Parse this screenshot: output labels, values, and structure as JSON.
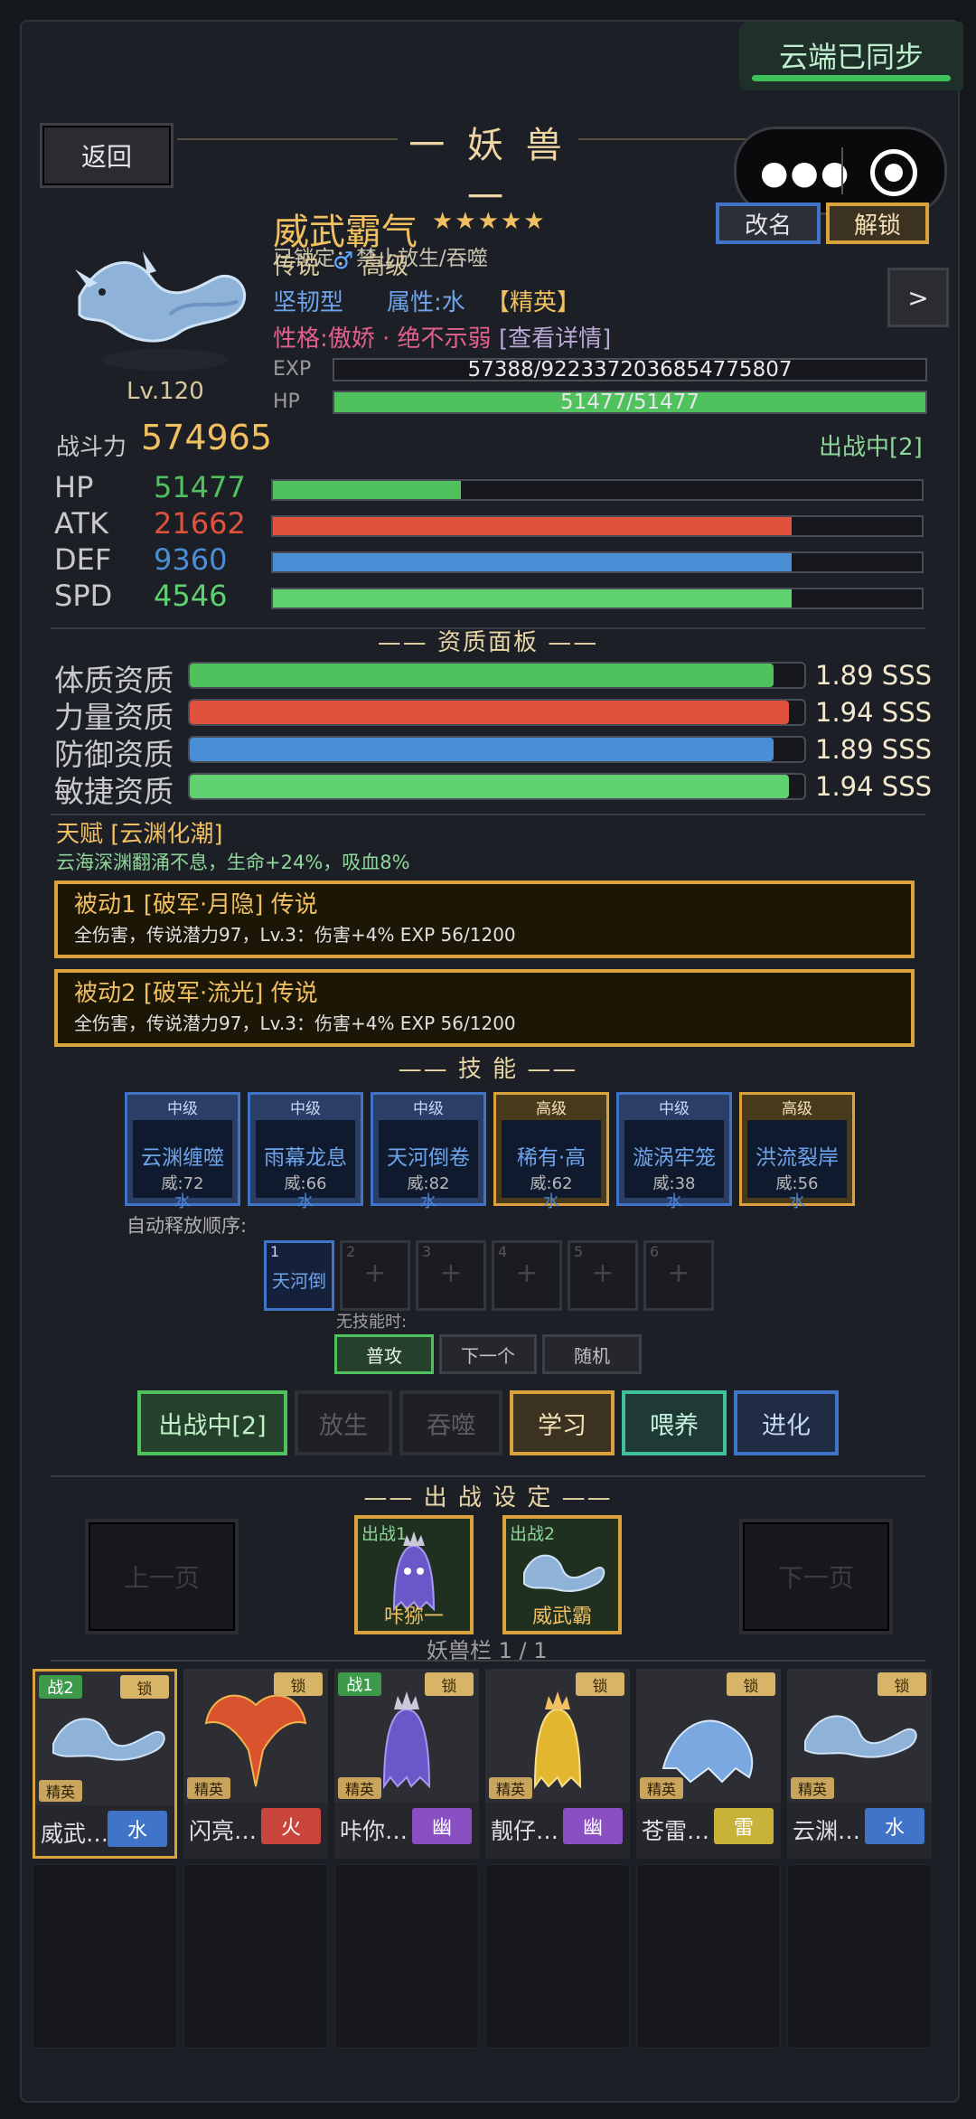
{
  "header": {
    "cloud_status": "云端已同步",
    "back": "返回",
    "title": "一 妖 兽 一"
  },
  "pet": {
    "name": "威武霸气",
    "stars": "★★★★★",
    "lock_info": "已锁定：禁止放生/吞噬",
    "rarity": "传说",
    "gender": "♂",
    "grade": "高级",
    "type": "坚韧型",
    "attr": "属性:水",
    "rank": "【精英】",
    "personality": "性格:傲娇 · 绝不示弱",
    "detail_link": "[查看详情]",
    "level": "Lv.120",
    "exp_label": "EXP",
    "exp_text": "57388/9223372036854775807",
    "exp_fraction": 0.0,
    "hp_label": "HP",
    "hp_text": "51477/51477",
    "hp_fraction": 1.0,
    "rename": "改名",
    "unlock": "解锁",
    "next": ">",
    "power_label": "战斗力",
    "power": "574965",
    "deploy_status": "出战中[2]"
  },
  "stats": [
    {
      "label": "HP",
      "value": "51477",
      "fraction": 0.29,
      "color": "#4fc25e"
    },
    {
      "label": "ATK",
      "value": "21662",
      "fraction": 0.8,
      "color": "#e0523e"
    },
    {
      "label": "DEF",
      "value": "9360",
      "fraction": 0.8,
      "color": "#4a8fd6"
    },
    {
      "label": "SPD",
      "value": "4546",
      "fraction": 0.8,
      "color": "#5fd16e"
    }
  ],
  "aptitude": {
    "title": "—— 资质面板 ——",
    "rows": [
      {
        "label": "体质资质",
        "value": "1.89 SSS",
        "fraction": 0.95,
        "color": "#4fc25e"
      },
      {
        "label": "力量资质",
        "value": "1.94 SSS",
        "fraction": 0.975,
        "color": "#e0523e"
      },
      {
        "label": "防御资质",
        "value": "1.89 SSS",
        "fraction": 0.95,
        "color": "#4a8fd6"
      },
      {
        "label": "敏捷资质",
        "value": "1.94 SSS",
        "fraction": 0.975,
        "color": "#5fd16e"
      }
    ]
  },
  "talent": {
    "title": "天赋 [云渊化潮]",
    "desc": "云海深渊翻涌不息，生命+24%，吸血8%"
  },
  "passives": [
    {
      "title": "被动1 [破军·月隐] 传说",
      "desc": "全伤害，传说潜力97，Lv.3：伤害+4%  EXP 56/1200"
    },
    {
      "title": "被动2 [破军·流光] 传说",
      "desc": "全伤害，传说潜力97，Lv.3：伤害+4%  EXP 56/1200"
    }
  ],
  "skills": {
    "title": "—— 技 能 ——",
    "items": [
      {
        "level": "中级",
        "name": "云渊缠噬",
        "power": "威:72",
        "element": "水",
        "tier": "mid"
      },
      {
        "level": "中级",
        "name": "雨幕龙息",
        "power": "威:66",
        "element": "水",
        "tier": "mid"
      },
      {
        "level": "中级",
        "name": "天河倒卷",
        "power": "威:82",
        "element": "水",
        "tier": "mid"
      },
      {
        "level": "高级",
        "name": "稀有·高",
        "power": "威:62",
        "element": "水",
        "tier": "high"
      },
      {
        "level": "中级",
        "name": "漩涡牢笼",
        "power": "威:38",
        "element": "水",
        "tier": "mid"
      },
      {
        "level": "高级",
        "name": "洪流裂岸",
        "power": "威:56",
        "element": "水",
        "tier": "high"
      }
    ],
    "auto_label": "自动释放顺序:",
    "slots": [
      {
        "num": "1",
        "text": "天河倒"
      },
      {
        "num": "2",
        "text": "+"
      },
      {
        "num": "3",
        "text": "+"
      },
      {
        "num": "4",
        "text": "+"
      },
      {
        "num": "5",
        "text": "+"
      },
      {
        "num": "6",
        "text": "+"
      }
    ],
    "no_skill_label": "无技能时:",
    "fallback": [
      "普攻",
      "下一个",
      "随机"
    ]
  },
  "actions": [
    "出战中[2]",
    "放生",
    "吞噬",
    "学习",
    "喂养",
    "进化"
  ],
  "deploy": {
    "title": "—— 出 战 设 定 ——",
    "prev": "上一页",
    "next": "下一页",
    "teams": [
      {
        "label": "出战1",
        "name": "咔猕一"
      },
      {
        "label": "出战2",
        "name": "威武霸"
      }
    ],
    "bag_label": "妖兽栏 1 / 1"
  },
  "roster": [
    {
      "badge": "战2",
      "lock": "锁",
      "rank": "精英",
      "name": "威武…",
      "element": "水",
      "el_color": "#3f74c9",
      "art": "dragon"
    },
    {
      "badge": "",
      "lock": "锁",
      "rank": "精英",
      "name": "闪亮…",
      "element": "火",
      "el_color": "#c9443a",
      "art": "phoenix"
    },
    {
      "badge": "战1",
      "lock": "锁",
      "rank": "精英",
      "name": "咔你…",
      "element": "幽",
      "el_color": "#8a4fc2",
      "art": "ghost"
    },
    {
      "badge": "",
      "lock": "锁",
      "rank": "精英",
      "name": "靓仔…",
      "element": "幽",
      "el_color": "#8a4fc2",
      "art": "goldghost"
    },
    {
      "badge": "",
      "lock": "锁",
      "rank": "精英",
      "name": "苍雷…",
      "element": "雷",
      "el_color": "#c9b23a",
      "art": "qilin"
    },
    {
      "badge": "",
      "lock": "锁",
      "rank": "精英",
      "name": "云渊…",
      "element": "水",
      "el_color": "#3f74c9",
      "art": "dragon"
    }
  ]
}
